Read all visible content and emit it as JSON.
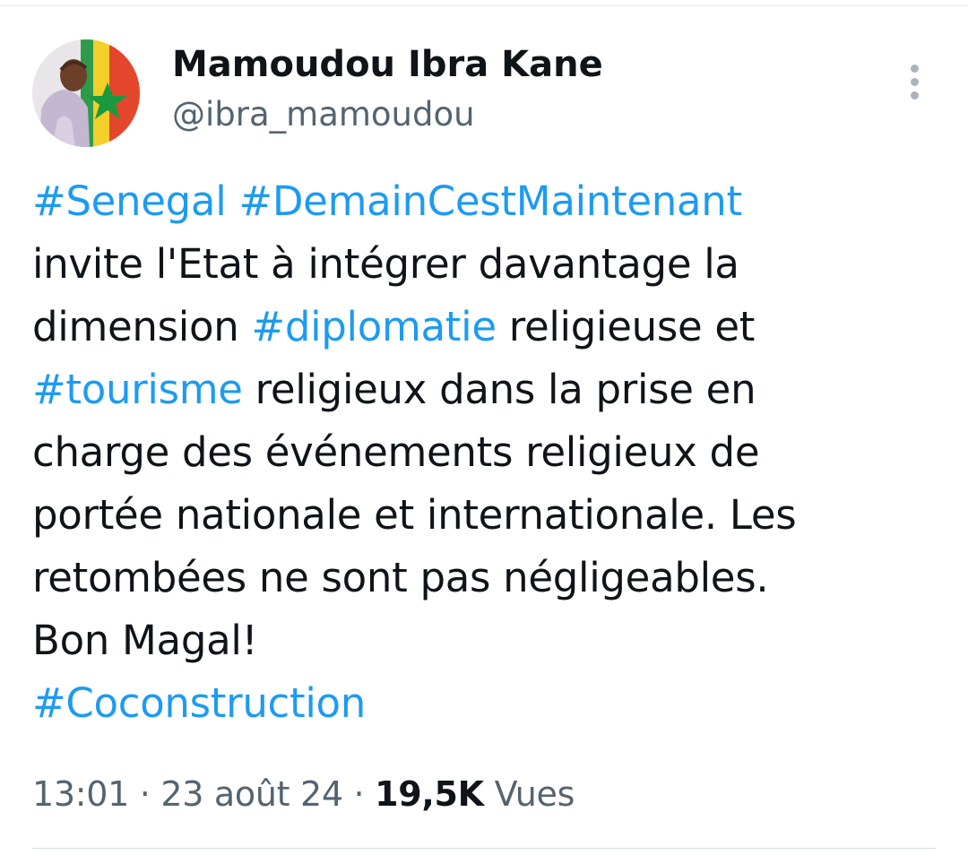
{
  "tweet": {
    "author": {
      "display_name": "Mamoudou Ibra Kane",
      "handle": "@ibra_mamoudou",
      "avatar_icon": "avatar-photo-senegal-flag"
    },
    "more_icon": "more-options-vertical-icon",
    "lines": [
      [
        {
          "text": "#Senegal",
          "hashtag": true
        },
        {
          "text": " ",
          "hashtag": false
        },
        {
          "text": "#DemainCestMaintenant",
          "hashtag": true
        }
      ],
      [
        {
          "text": "invite l'Etat à intégrer davantage la",
          "hashtag": false
        }
      ],
      [
        {
          "text": "dimension ",
          "hashtag": false
        },
        {
          "text": "#diplomatie",
          "hashtag": true
        },
        {
          "text": " religieuse et",
          "hashtag": false
        }
      ],
      [
        {
          "text": "#tourisme",
          "hashtag": true
        },
        {
          "text": " religieux dans la prise en",
          "hashtag": false
        }
      ],
      [
        {
          "text": "charge des événements religieux de",
          "hashtag": false
        }
      ],
      [
        {
          "text": "portée nationale et internationale. Les",
          "hashtag": false
        }
      ],
      [
        {
          "text": "retombées ne sont pas négligeables.",
          "hashtag": false
        }
      ],
      [
        {
          "text": "Bon Magal!",
          "hashtag": false
        }
      ],
      [
        {
          "text": "#Coconstruction",
          "hashtag": true
        }
      ]
    ],
    "meta": {
      "time": "13:01",
      "separator": " · ",
      "date": "23 août 24",
      "views_count": "19,5K",
      "views_label": " Vues"
    }
  },
  "colors": {
    "hashtag": "#1d9bf0",
    "text": "#0f1419",
    "secondary": "#536471"
  }
}
